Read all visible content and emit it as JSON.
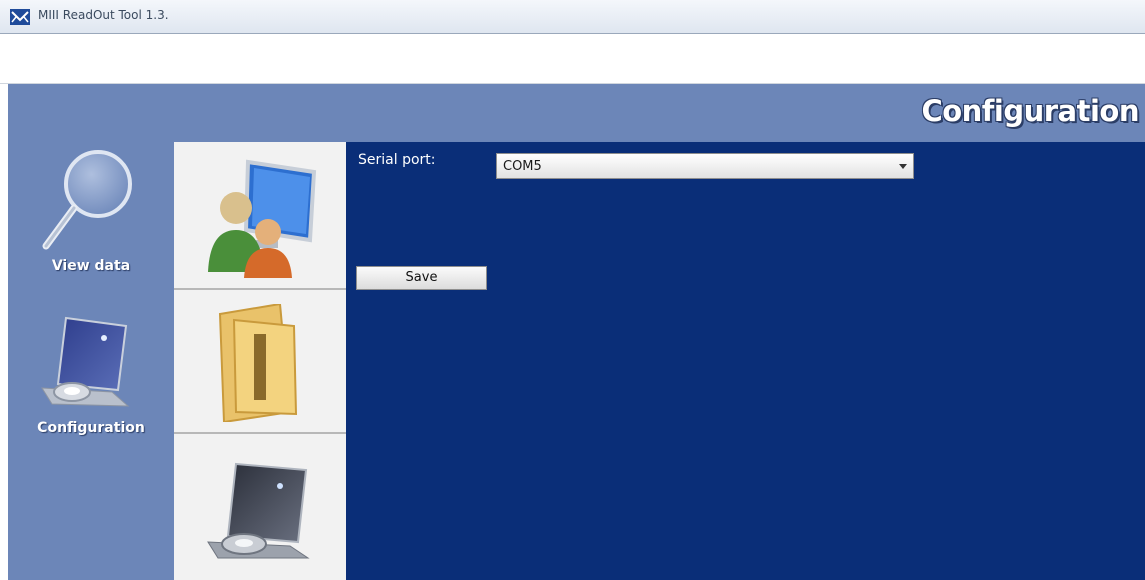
{
  "window": {
    "title": "MIII ReadOut Tool 1.3.",
    "logo_icon": "app-logo-icon"
  },
  "header": {
    "title": "Configuration"
  },
  "nav": {
    "items": [
      {
        "label": "View data",
        "icon": "magnifier-icon"
      },
      {
        "label": "Configuration",
        "icon": "config-device-icon"
      }
    ]
  },
  "thumbnails": [
    {
      "icon": "users-computer-icon"
    },
    {
      "icon": "folder-icon"
    },
    {
      "icon": "config-device-icon"
    }
  ],
  "settings": {
    "serial_port_label": "Serial port:",
    "serial_port_value": "COM5",
    "save_label": "Save"
  },
  "colors": {
    "content_background": "#0a2e78",
    "body_background": "#6c86b8",
    "header_text": "#ffffff"
  }
}
